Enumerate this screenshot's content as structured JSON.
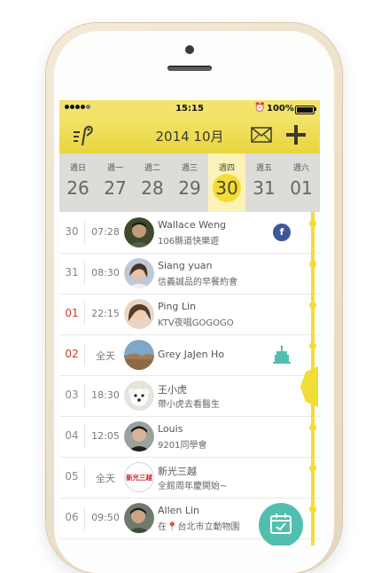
{
  "status_bar": {
    "time": "15:15",
    "battery": "100%"
  },
  "header": {
    "title": "2014 10月"
  },
  "week": [
    {
      "name": "週日",
      "num": "26",
      "selected": false
    },
    {
      "name": "週一",
      "num": "27",
      "selected": false
    },
    {
      "name": "週二",
      "num": "28",
      "selected": false
    },
    {
      "name": "週三",
      "num": "29",
      "selected": false
    },
    {
      "name": "週四",
      "num": "30",
      "selected": true
    },
    {
      "name": "週五",
      "num": "31",
      "selected": false
    },
    {
      "name": "週六",
      "num": "01",
      "selected": false
    }
  ],
  "events": [
    {
      "date": "30",
      "time": "07:28",
      "name": "Wallace Weng",
      "event": "106縣道快樂遊",
      "badge": "facebook-icon",
      "red": false
    },
    {
      "date": "31",
      "time": "08:30",
      "name": "Siang yuan",
      "event": "信義誠品的早餐約會",
      "badge": "",
      "red": false
    },
    {
      "date": "01",
      "time": "22:15",
      "name": "Ping Lin",
      "event": "KTV夜唱GOGOGO",
      "badge": "",
      "red": true
    },
    {
      "date": "02",
      "time": "全天",
      "name": "Grey JaJen Ho",
      "event": "",
      "badge": "birthday-cake-icon",
      "red": true
    },
    {
      "date": "03",
      "time": "18:30",
      "name": "王小虎",
      "event": "帶小虎去看醫生",
      "badge": "",
      "red": false
    },
    {
      "date": "04",
      "time": "12:05",
      "name": "Louis",
      "event": "9201同學會",
      "badge": "",
      "red": false
    },
    {
      "date": "05",
      "time": "全天",
      "name": "新光三越",
      "event": "全館周年慶開始~",
      "badge": "",
      "red": false
    },
    {
      "date": "06",
      "time": "09:50",
      "name": "Allen Lin",
      "event": "在台北市立動物園",
      "badge": "",
      "red": false
    }
  ],
  "logo_text": "新光三越",
  "colors": {
    "accent": "#f2dc36",
    "header_bg": "#f3e36a",
    "fab": "#52bfae",
    "facebook": "#3b5998",
    "weekend_red": "#d23a2a"
  }
}
